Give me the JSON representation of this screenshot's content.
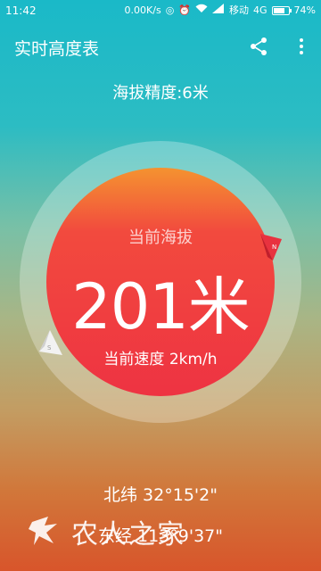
{
  "status_bar": {
    "time": "11:42",
    "net_speed": "0.00K/s",
    "carrier": "移动",
    "network": "4G",
    "battery_percent": "74%",
    "battery_level": 0.74
  },
  "app_bar": {
    "title": "实时高度表",
    "share_icon": "share-icon",
    "more_icon": "more-vert-icon"
  },
  "accuracy_text": "海拔精度:6米",
  "gauge": {
    "label": "当前海拔",
    "altitude_text": "201米",
    "speed_text": "当前速度 2km/h",
    "north_marker": "N",
    "south_marker": "S"
  },
  "coordinates": {
    "latitude_text": "北纬 32°15'2\"",
    "longitude_text": "东经 113°9'37\""
  },
  "watermark": {
    "text": "农人之家"
  },
  "colors": {
    "bg_top": "#1ab9c8",
    "bg_bottom": "#d8552b",
    "disc_top": "#f49330",
    "disc_main": "#ee3342"
  }
}
